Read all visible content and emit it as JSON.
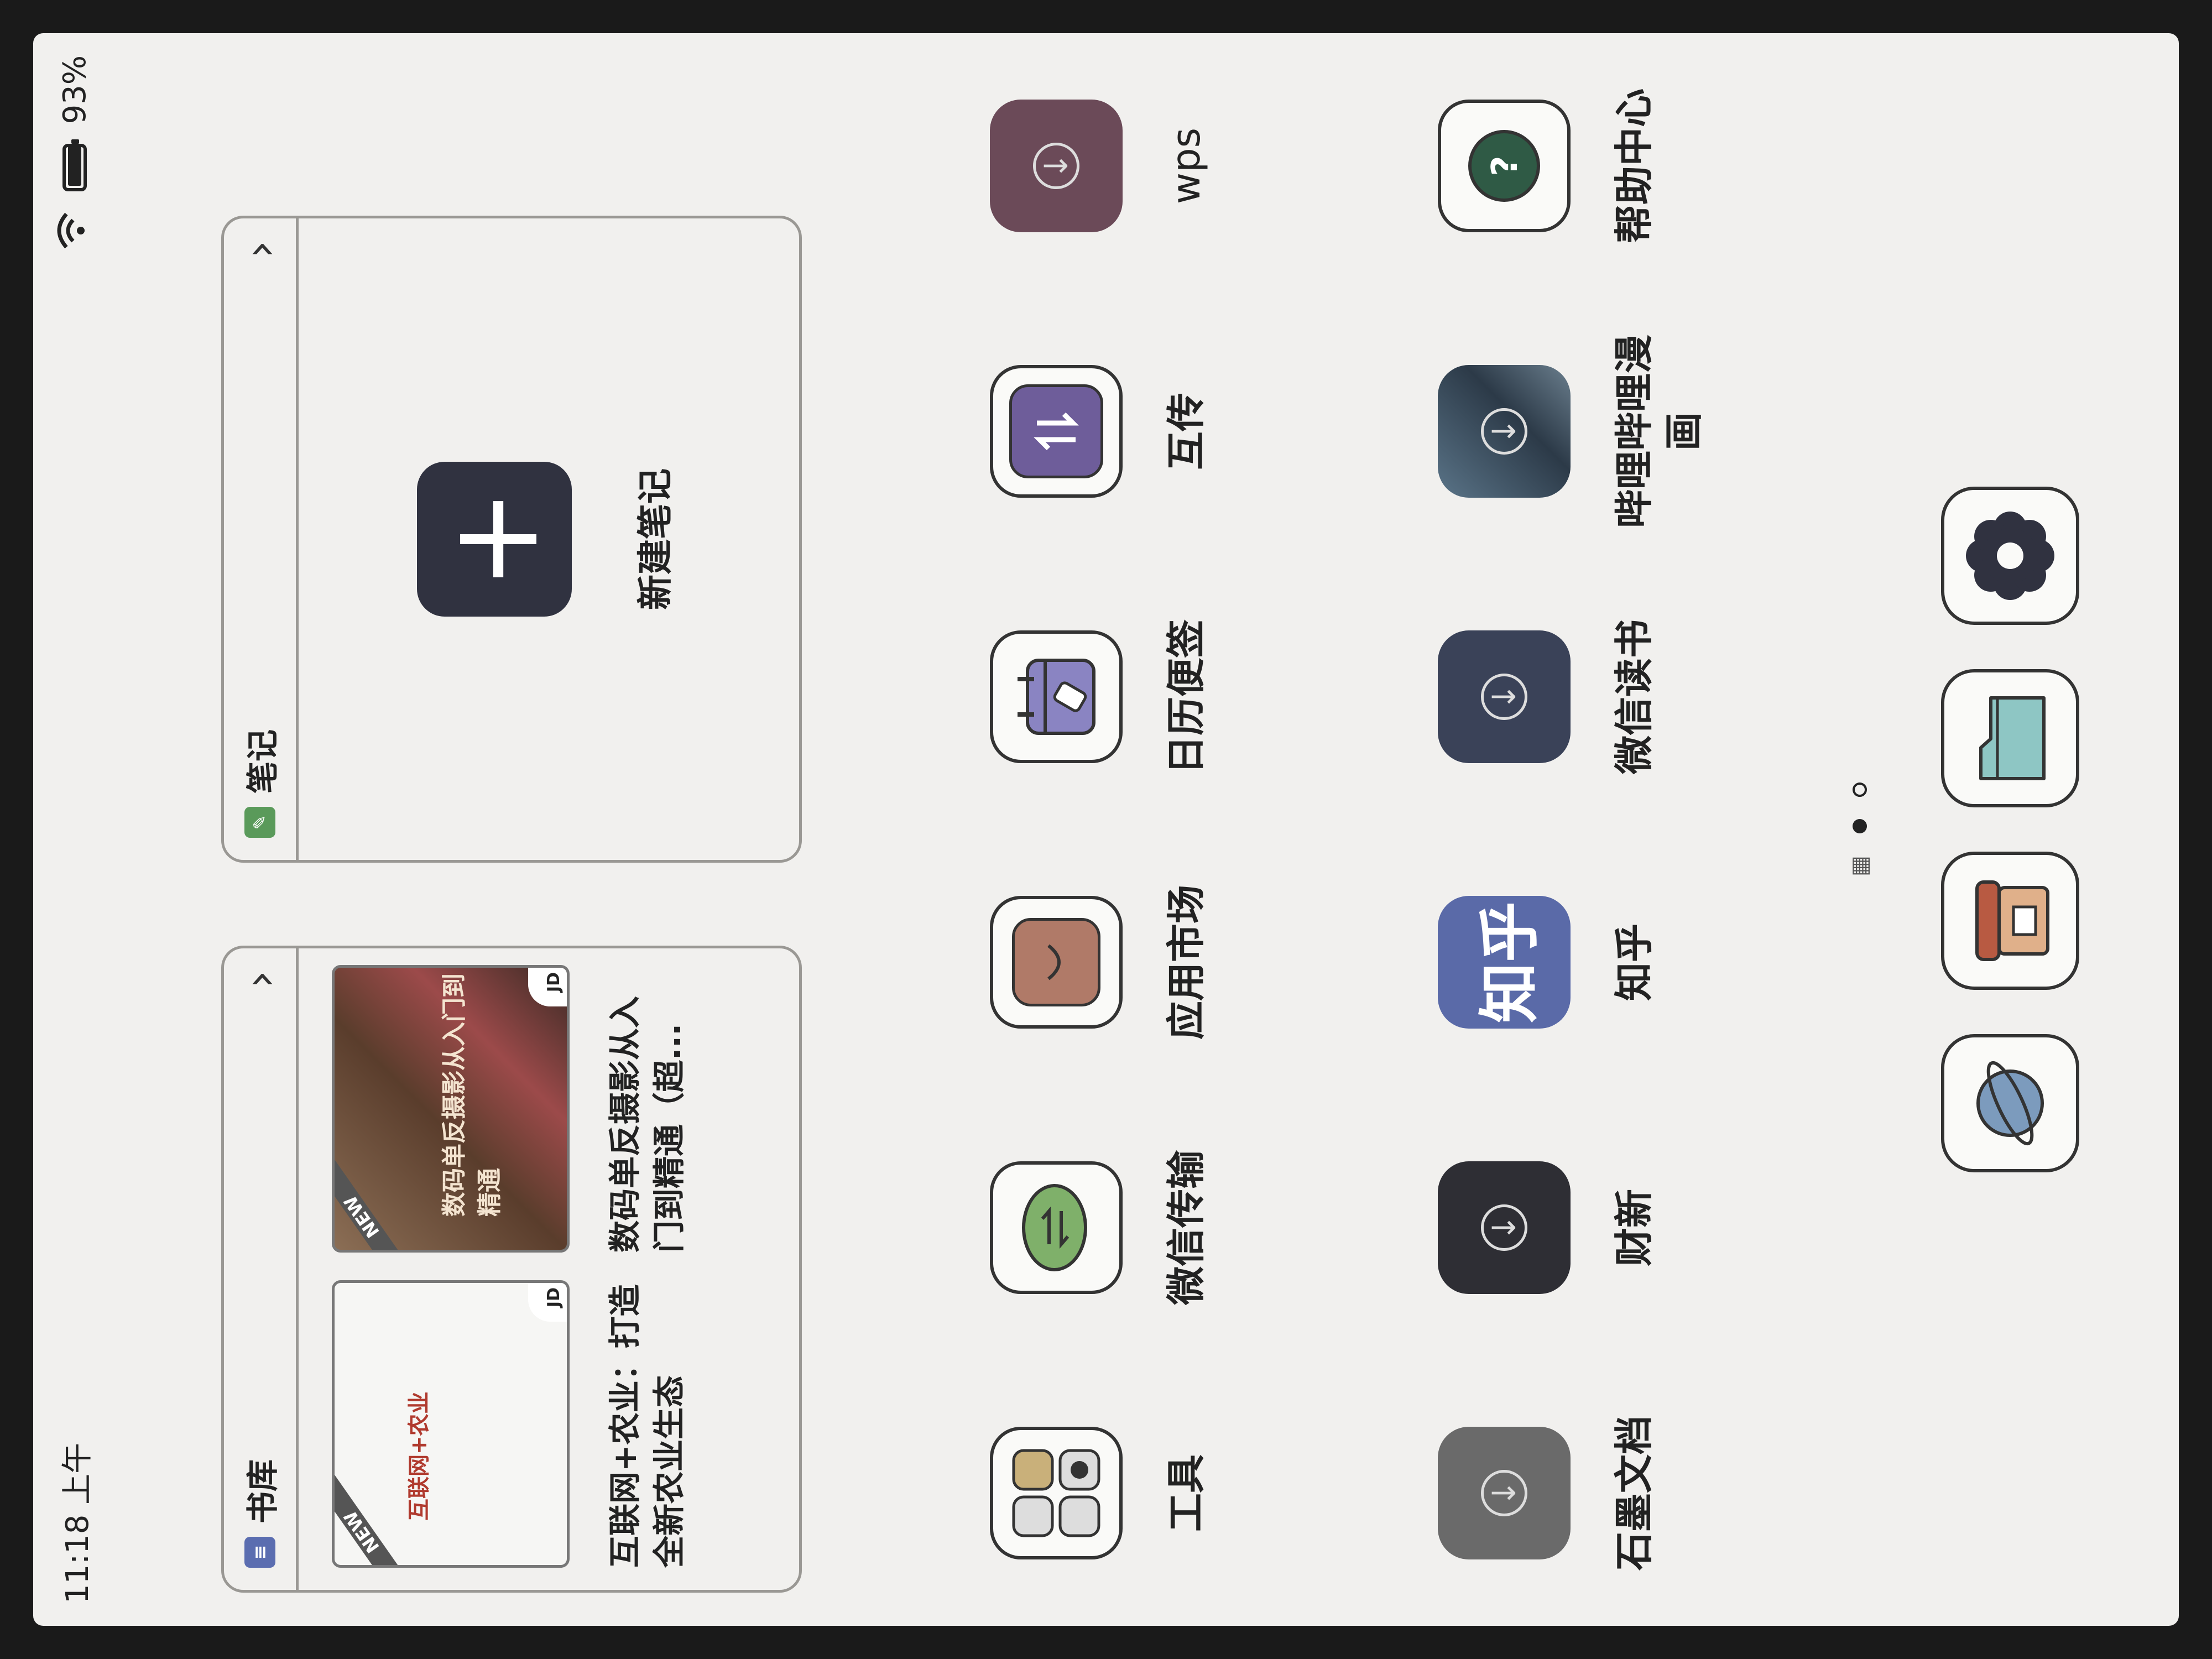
{
  "status": {
    "time": "11:18 上午",
    "battery": "93%"
  },
  "library": {
    "title": "书库",
    "books": [
      {
        "tag": "NEW",
        "badge": "JD",
        "cover_text": "互联网+农业",
        "title": "互联网+农业：打造全新农业生态"
      },
      {
        "tag": "NEW",
        "badge": "JD",
        "cover_text": "数码单反摄影从入门到精通",
        "title": "数码单反摄影从入门到精通（超..."
      }
    ]
  },
  "notes": {
    "title": "笔记",
    "new_label": "新建笔记"
  },
  "apps": [
    {
      "label": "工具"
    },
    {
      "label": "微信传输"
    },
    {
      "label": "应用市场"
    },
    {
      "label": "日历便签"
    },
    {
      "label": "互传"
    },
    {
      "label": "wps"
    },
    {
      "label": "石墨文档"
    },
    {
      "label": "财新"
    },
    {
      "label": "知乎",
      "icon_text": "知乎"
    },
    {
      "label": "微信读书"
    },
    {
      "label": "哔哩哔哩漫画"
    },
    {
      "label": "帮助中心"
    }
  ],
  "dock": [
    {
      "icon": "planet-icon"
    },
    {
      "icon": "store-icon"
    },
    {
      "icon": "folder-icon"
    },
    {
      "icon": "settings-icon"
    }
  ],
  "pager": {
    "current": 1,
    "total": 2
  },
  "colors": {
    "wechat_green": "#7fb06a",
    "market_brown": "#b07a68",
    "calendar_purple": "#8a84c2",
    "transfer_purple": "#6e5d9a",
    "folder_teal": "#8ec6c4",
    "planet_blue": "#7c9bbd",
    "store_red": "#b85a42"
  }
}
